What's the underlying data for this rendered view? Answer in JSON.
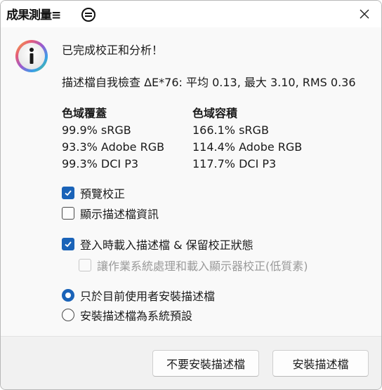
{
  "window": {
    "title": "成果測量≡"
  },
  "message": {
    "headline": "已完成校正和分析！",
    "check_line": "描述檔自我檢查 ΔE*76: 平均 0.13, 最大 3.10, RMS 0.36"
  },
  "gamut_coverage": {
    "header": "色域覆蓋",
    "rows": [
      "99.9% sRGB",
      "93.3% Adobe RGB",
      "99.3% DCI P3"
    ]
  },
  "gamut_volume": {
    "header": "色域容積",
    "rows": [
      "166.1% sRGB",
      "114.4% Adobe RGB",
      "117.7% DCI P3"
    ]
  },
  "options": {
    "preview": {
      "label": "預覽校正",
      "checked": true
    },
    "show_profile_info": {
      "label": "顯示描述檔資訊",
      "checked": false
    },
    "load_on_login": {
      "label": "登入時載入描述檔 & 保留校正狀態",
      "checked": true
    },
    "os_handling": {
      "label": "讓作業系統處理和載入顯示器校正(低質素)",
      "checked": false,
      "disabled": true
    }
  },
  "install_scope": {
    "current_user": {
      "label": "只於目前使用者安裝描述檔",
      "selected": true
    },
    "system_default": {
      "label": "安裝描述檔為系統預設",
      "selected": false
    }
  },
  "buttons": {
    "decline": "不要安裝描述檔",
    "install": "安裝描述檔"
  },
  "colors": {
    "accent": "#1a63b8",
    "background": "#f9f9f9",
    "footer": "#f1f1f1"
  },
  "icons": {
    "info": "info-icon",
    "close": "close-icon",
    "app": "app-icon"
  }
}
